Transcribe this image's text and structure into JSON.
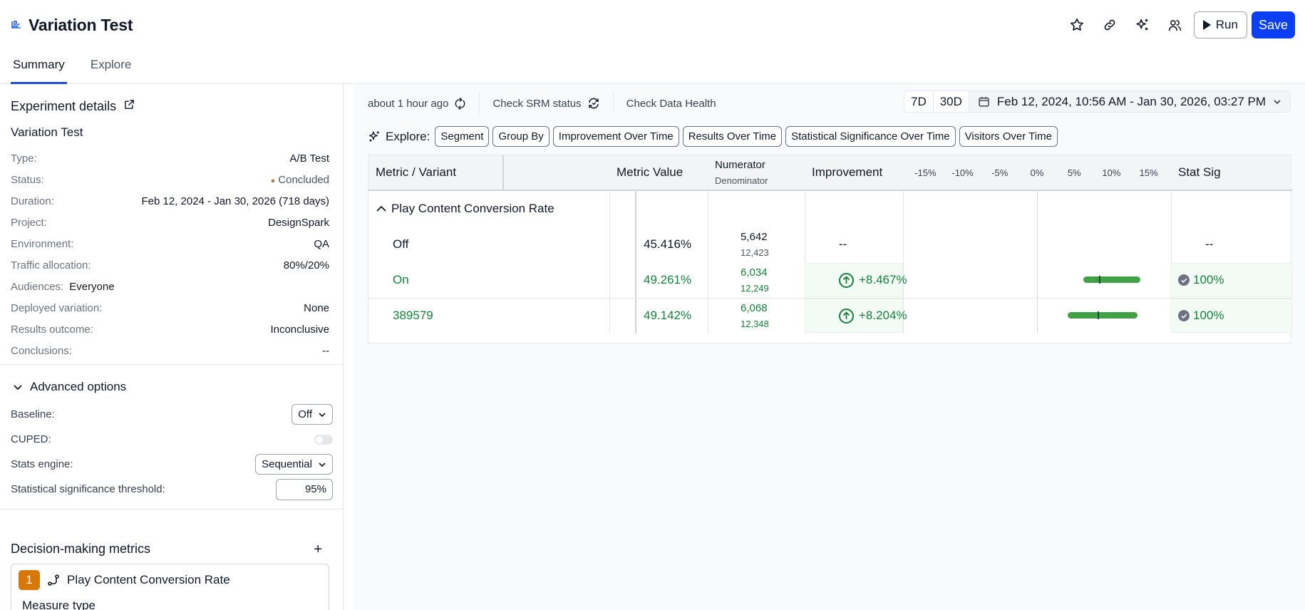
{
  "header": {
    "title": "Variation Test",
    "tabs": [
      "Summary",
      "Explore"
    ],
    "run_label": "Run",
    "save_label": "Save"
  },
  "details": {
    "title": "Experiment details",
    "name": "Variation Test",
    "rows": [
      {
        "k": "Type:",
        "v": "A/B Test"
      },
      {
        "k": "Status:",
        "v": "Concluded"
      },
      {
        "k": "Duration:",
        "v": "Feb 12, 2024 - Jan 30, 2026 (718 days)"
      },
      {
        "k": "Project:",
        "v": "DesignSpark"
      },
      {
        "k": "Environment:",
        "v": "QA"
      },
      {
        "k": "Traffic allocation:",
        "v": "80%/20%"
      },
      {
        "k": "Audiences:",
        "v": "Everyone"
      },
      {
        "k": "Deployed variation:",
        "v": "None"
      },
      {
        "k": "Results outcome:",
        "v": "Inconclusive"
      },
      {
        "k": "Conclusions:",
        "v": "--"
      }
    ]
  },
  "advanced": {
    "title": "Advanced options",
    "baseline_label": "Baseline:",
    "baseline_value": "Off",
    "cuped_label": "CUPED:",
    "cuped_on": false,
    "engine_label": "Stats engine:",
    "engine_value": "Sequential",
    "threshold_label": "Statistical significance threshold:",
    "threshold_value": "95",
    "threshold_unit": "%"
  },
  "decision": {
    "title": "Decision-making metrics",
    "metric_number": "1",
    "metric_name": "Play Content Conversion Rate",
    "measure_type": "Measure type"
  },
  "toolbar": {
    "updated": "about 1 hour ago",
    "srm": "Check SRM status",
    "health": "Check Data Health",
    "range_7d": "7D",
    "range_30d": "30D",
    "date_range": "Feb 12, 2024, 10:56 AM - Jan 30, 2026, 03:27 PM"
  },
  "explore": {
    "label": "Explore:",
    "chips": [
      "Segment",
      "Group By",
      "Improvement Over Time",
      "Results Over Time",
      "Statistical Significance Over Time",
      "Visitors Over Time"
    ]
  },
  "table": {
    "headers": {
      "metric": "Metric / Variant",
      "value": "Metric Value",
      "numerator": "Numerator",
      "denominator": "Denominator",
      "improvement": "Improvement",
      "statsig": "Stat Sig"
    },
    "axis_ticks": [
      "-15%",
      "-10%",
      "-5%",
      "0%",
      "5%",
      "10%",
      "15%"
    ],
    "axis_range": [
      -18,
      18
    ],
    "metric_name": "Play Content Conversion Rate",
    "rows": [
      {
        "variant": "Off",
        "value": "45.416%",
        "num": "5,642",
        "den": "12,423",
        "improvement": "--",
        "statsig": "--",
        "baseline": true
      },
      {
        "variant": "On",
        "value": "49.261%",
        "num": "6,034",
        "den": "12,249",
        "improvement": "+8.467%",
        "statsig": "100%",
        "ci": [
          6.2,
          13.9
        ],
        "point": 8.467
      },
      {
        "variant": "389579",
        "value": "49.142%",
        "num": "6,068",
        "den": "12,348",
        "improvement": "+8.204%",
        "statsig": "100%",
        "ci": [
          4.1,
          13.5
        ],
        "point": 8.204
      }
    ]
  },
  "colors": {
    "accent": "#0b3ff5",
    "positive": "#16803c",
    "ci_bar": "#43a047",
    "metric_badge": "#d97706"
  }
}
